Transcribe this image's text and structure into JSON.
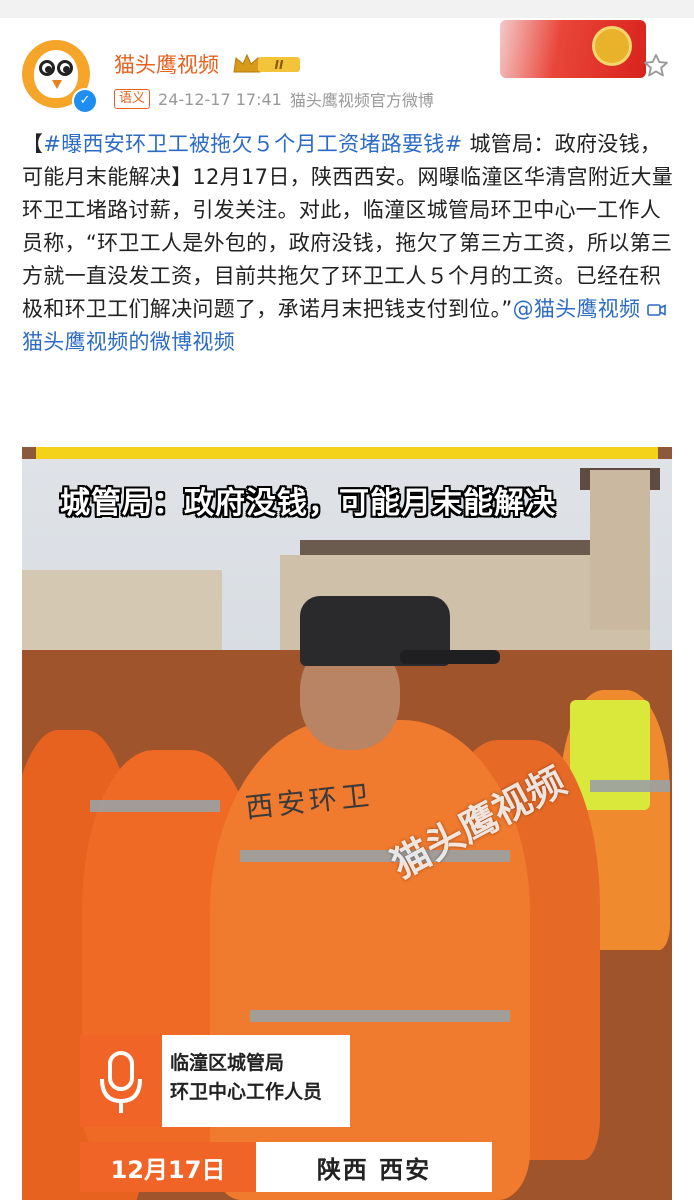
{
  "header": {
    "username": "猫头鹰视频",
    "badge_level": "II",
    "tag": "语义",
    "timestamp": "24-12-17 17:41",
    "source": "猫头鹰视频官方微博"
  },
  "post": {
    "hashtag": "#曝西安环卫工被拖欠５个月工资堵路要钱#",
    "text": "【#曝西安环卫工被拖欠５个月工资堵路要钱# 城管局：政府没钱，可能月末能解决】12月17日，陕西西安。网曝临潼区华清宫附近大量环卫工堵路讨薪，引发关注。对此，临潼区城管局环卫中心一工作人员称，“环卫工人是外包的，政府没钱，拖欠了第三方工资，所以第三方就一直没发工资，目前共拖欠了环卫工人５个月的工资。已经在积极和环卫工们解决问题了，承诺月末把钱支付到位。”",
    "text_part1": "【",
    "text_part2": " 城管局：政府没钱，可能月末能解决】12月17日，陕西西安。网曝临潼区华清宫附近大量环卫工堵路讨薪，引发关注。对此，临潼区城管局环卫中心一工作人员称，“环卫工人是外包的，政府没钱，拖欠了第三方工资，所以第三方就一直没发工资，目前共拖欠了环卫工人５个月的工资。已经在积极和环卫工们解决问题了，承诺月末把钱支付到位。”",
    "mention": "@猫头鹰视频",
    "video_link": "猫头鹰视频的微博视频"
  },
  "video": {
    "title_overlay": "城管局：政府没钱，可能月末能解决",
    "back_text": "西安环卫",
    "watermark": "猫头鹰视频",
    "caption_line1": "临潼区城管局",
    "caption_line2": "环卫中心工作人员",
    "date": "12月17日",
    "location": "陕西 西安"
  },
  "colors": {
    "accent_orange": "#e8611c",
    "link_blue": "#2c6bc4",
    "caption_orange": "#f06428"
  }
}
